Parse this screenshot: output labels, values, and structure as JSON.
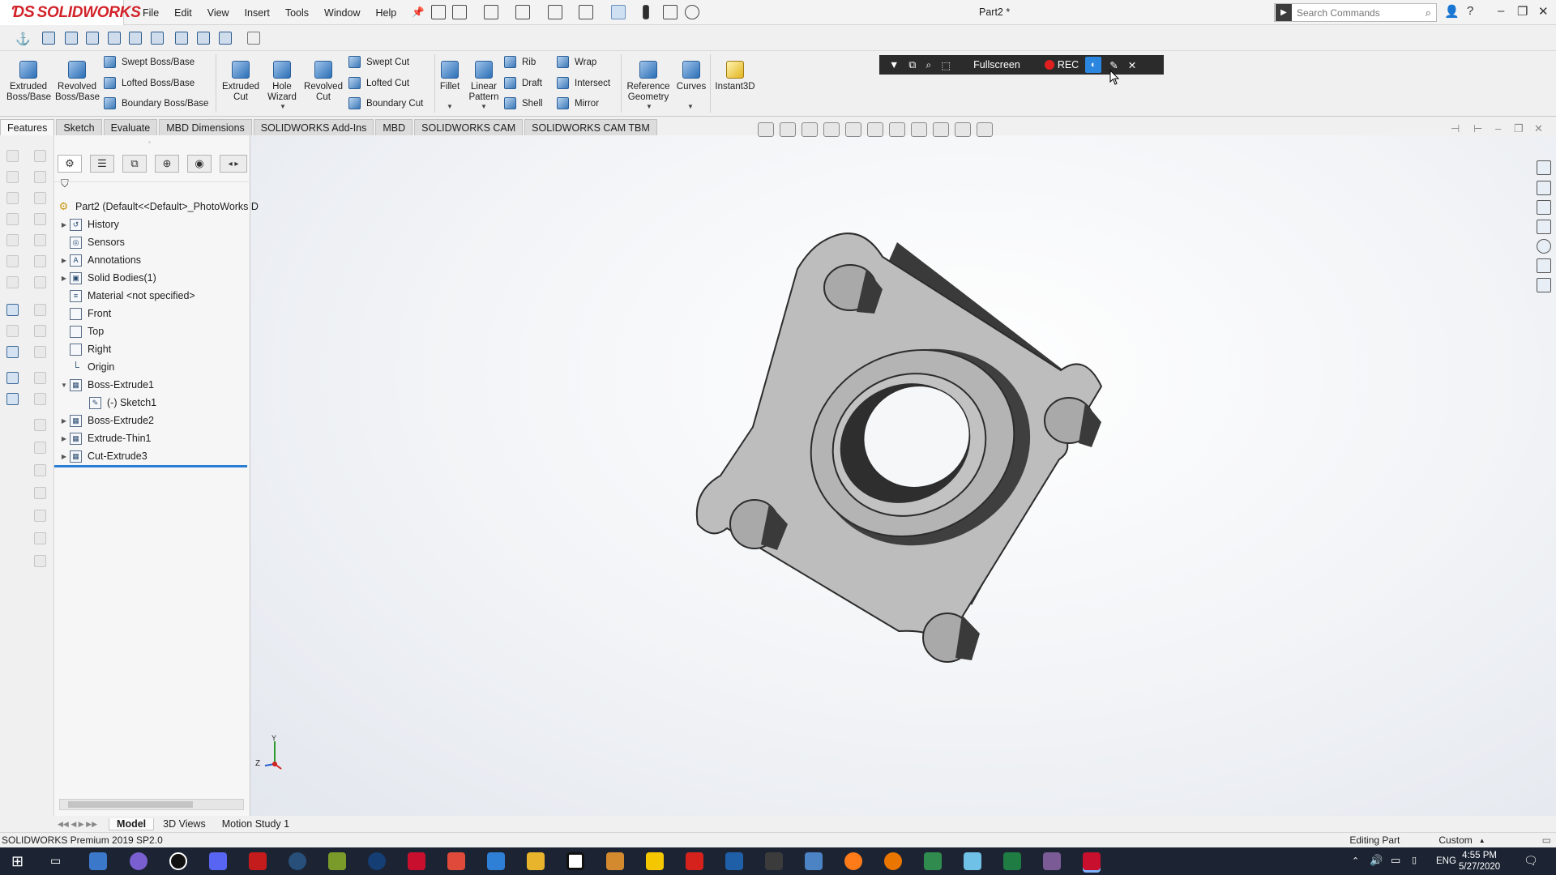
{
  "app": {
    "logo": "SOLIDWORKS",
    "menu": [
      "File",
      "Edit",
      "View",
      "Insert",
      "Tools",
      "Window",
      "Help"
    ],
    "document_title": "Part2 *",
    "search_placeholder": "Search Commands"
  },
  "command_manager": {
    "large": [
      {
        "label": "Extruded Boss/Base"
      },
      {
        "label": "Revolved Boss/Base"
      },
      {
        "label": "Extruded Cut"
      },
      {
        "label": "Hole Wizard"
      },
      {
        "label": "Revolved Cut"
      },
      {
        "label": "Fillet"
      },
      {
        "label": "Linear Pattern"
      },
      {
        "label": "Reference Geometry"
      },
      {
        "label": "Curves"
      },
      {
        "label": "Instant3D"
      }
    ],
    "small": [
      {
        "label": "Swept Boss/Base"
      },
      {
        "label": "Lofted Boss/Base"
      },
      {
        "label": "Boundary Boss/Base"
      },
      {
        "label": "Swept Cut"
      },
      {
        "label": "Lofted Cut"
      },
      {
        "label": "Boundary Cut"
      },
      {
        "label": "Rib"
      },
      {
        "label": "Draft"
      },
      {
        "label": "Shell"
      },
      {
        "label": "Wrap"
      },
      {
        "label": "Intersect"
      },
      {
        "label": "Mirror"
      }
    ]
  },
  "recorder": {
    "fullscreen": "Fullscreen",
    "rec": "REC"
  },
  "tabs": [
    "Features",
    "Sketch",
    "Evaluate",
    "MBD Dimensions",
    "SOLIDWORKS Add-Ins",
    "MBD",
    "SOLIDWORKS CAM",
    "SOLIDWORKS CAM TBM"
  ],
  "tree": {
    "root": "Part2  (Default<<Default>_PhotoWorks D",
    "items": [
      {
        "label": "History"
      },
      {
        "label": "Sensors"
      },
      {
        "label": "Annotations"
      },
      {
        "label": "Solid Bodies(1)"
      },
      {
        "label": "Material <not specified>"
      },
      {
        "label": "Front"
      },
      {
        "label": "Top"
      },
      {
        "label": "Right"
      },
      {
        "label": "Origin"
      },
      {
        "label": "Boss-Extrude1"
      },
      {
        "label": "(-) Sketch1"
      },
      {
        "label": "Boss-Extrude2"
      },
      {
        "label": "Extrude-Thin1"
      },
      {
        "label": "Cut-Extrude3"
      }
    ]
  },
  "bottom_tabs": [
    "Model",
    "3D Views",
    "Motion Study 1"
  ],
  "status": {
    "left": "SOLIDWORKS Premium 2019 SP2.0",
    "mode": "Editing Part",
    "units": "Custom"
  },
  "triad": {
    "x": "Z",
    "y": "Y"
  },
  "taskbar": {
    "lang": "ENG",
    "time": "4:55 PM",
    "date": "5/27/2020"
  },
  "colors": {
    "brand": "#d2232a",
    "part_face": "#bdbdbd",
    "part_side": "#3a3a3a",
    "taskbar": "#1c2433"
  }
}
